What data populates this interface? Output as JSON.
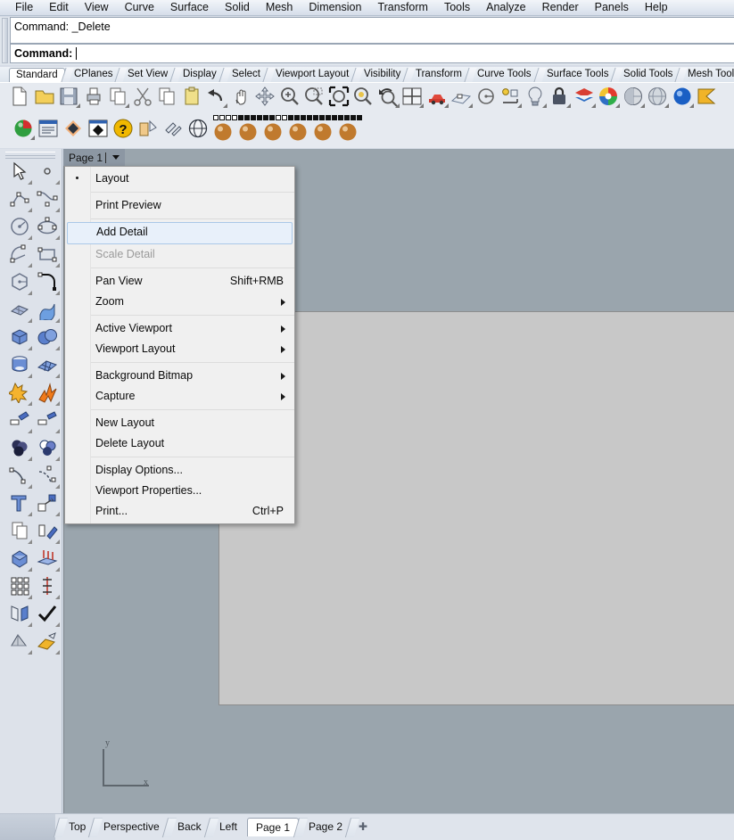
{
  "menubar": {
    "items": [
      {
        "label": "File"
      },
      {
        "label": "Edit"
      },
      {
        "label": "View"
      },
      {
        "label": "Curve"
      },
      {
        "label": "Surface"
      },
      {
        "label": "Solid"
      },
      {
        "label": "Mesh"
      },
      {
        "label": "Dimension"
      },
      {
        "label": "Transform"
      },
      {
        "label": "Tools"
      },
      {
        "label": "Analyze"
      },
      {
        "label": "Render"
      },
      {
        "label": "Panels"
      },
      {
        "label": "Help"
      }
    ]
  },
  "command": {
    "history": "Command: _Delete",
    "prompt_label": "Command:",
    "input_value": ""
  },
  "toolbar_tabs": {
    "active": "Standard",
    "items": [
      {
        "label": "Standard"
      },
      {
        "label": "CPlanes"
      },
      {
        "label": "Set View"
      },
      {
        "label": "Display"
      },
      {
        "label": "Select"
      },
      {
        "label": "Viewport Layout"
      },
      {
        "label": "Visibility"
      },
      {
        "label": "Transform"
      },
      {
        "label": "Curve Tools"
      },
      {
        "label": "Surface Tools"
      },
      {
        "label": "Solid Tools"
      },
      {
        "label": "Mesh Tools"
      }
    ]
  },
  "toolbar_row1": {
    "icons": [
      {
        "name": "new-file-icon",
        "flyout": false
      },
      {
        "name": "open-folder-icon",
        "flyout": false
      },
      {
        "name": "save-icon",
        "flyout": true
      },
      {
        "name": "print-icon",
        "flyout": false
      },
      {
        "name": "copy-to-clipboard-icon",
        "flyout": true
      },
      {
        "name": "cut-scissors-icon",
        "flyout": false
      },
      {
        "name": "copy-icon",
        "flyout": false
      },
      {
        "name": "paste-icon",
        "flyout": false
      },
      {
        "name": "undo-icon",
        "flyout": true
      },
      {
        "name": "pan-hand-icon",
        "flyout": false
      },
      {
        "name": "move-gumball-icon",
        "flyout": false
      },
      {
        "name": "zoom-in-icon",
        "flyout": false
      },
      {
        "name": "zoom-window-icon",
        "flyout": false
      },
      {
        "name": "zoom-extents-icon",
        "flyout": false
      },
      {
        "name": "zoom-selected-icon",
        "flyout": false
      },
      {
        "name": "zoom-previous-icon",
        "flyout": true
      },
      {
        "name": "viewport-layout-icon",
        "flyout": true
      },
      {
        "name": "car-render-icon",
        "flyout": true
      },
      {
        "name": "grid-snap-icon",
        "flyout": true
      },
      {
        "name": "circle-center-icon",
        "flyout": false
      },
      {
        "name": "object-snap-icon",
        "flyout": true
      },
      {
        "name": "light-bulb-icon",
        "flyout": true
      },
      {
        "name": "lock-icon",
        "flyout": true
      },
      {
        "name": "layers-icon",
        "flyout": true
      },
      {
        "name": "color-wheel-icon",
        "flyout": true
      },
      {
        "name": "shade-sphere-icon",
        "flyout": true
      },
      {
        "name": "ghosted-sphere-icon",
        "flyout": true
      },
      {
        "name": "rendered-sphere-icon",
        "flyout": true
      },
      {
        "name": "flag-render-icon",
        "flyout": false
      }
    ]
  },
  "toolbar_row2": {
    "icons": [
      {
        "name": "render-sphere-green-icon",
        "flyout": true
      },
      {
        "name": "properties-panel-icon",
        "flyout": false
      },
      {
        "name": "diamond-orange-icon",
        "flyout": false
      },
      {
        "name": "diamond-window-icon",
        "flyout": false
      },
      {
        "name": "help-question-icon",
        "flyout": false
      },
      {
        "name": "extrude-cone-icon",
        "flyout": false
      },
      {
        "name": "join-icon",
        "flyout": false
      },
      {
        "name": "wireframe-sphere-icon",
        "flyout": false
      },
      {
        "name": "material-sphere-icon",
        "flyout": false
      },
      {
        "name": "material-sphere-2-icon",
        "flyout": false
      },
      {
        "name": "material-sphere-3-icon",
        "flyout": false
      },
      {
        "name": "material-sphere-4-icon",
        "flyout": false
      },
      {
        "name": "material-sphere-5-icon",
        "flyout": false
      },
      {
        "name": "material-sphere-6-icon",
        "flyout": false
      }
    ]
  },
  "sidebar": {
    "icons": [
      {
        "name": "select-arrow-icon"
      },
      {
        "name": "point-icon"
      },
      {
        "name": "polyline-icon"
      },
      {
        "name": "control-point-curve-icon"
      },
      {
        "name": "circle-icon"
      },
      {
        "name": "ellipse-icon"
      },
      {
        "name": "arc-icon"
      },
      {
        "name": "rectangle-icon"
      },
      {
        "name": "polygon-icon"
      },
      {
        "name": "curve-fillet-icon"
      },
      {
        "name": "surface-from-points-icon"
      },
      {
        "name": "surface-loft-icon"
      },
      {
        "name": "box-solid-icon"
      },
      {
        "name": "sphere-solid-icon"
      },
      {
        "name": "cylinder-solid-icon"
      },
      {
        "name": "surface-mesh-icon"
      },
      {
        "name": "boolean-union-icon"
      },
      {
        "name": "explode-icon"
      },
      {
        "name": "trim-icon"
      },
      {
        "name": "split-icon"
      },
      {
        "name": "boolean-difference-icon"
      },
      {
        "name": "boolean-intersect-icon"
      },
      {
        "name": "offset-curve-icon"
      },
      {
        "name": "blend-curve-icon"
      },
      {
        "name": "text-tool-icon"
      },
      {
        "name": "scale-icon"
      },
      {
        "name": "copy-objects-icon"
      },
      {
        "name": "rotate-icon"
      },
      {
        "name": "cap-solid-icon"
      },
      {
        "name": "extrude-surface-icon"
      },
      {
        "name": "array-grid-icon"
      },
      {
        "name": "dimension-linear-icon"
      },
      {
        "name": "mirror-icon"
      },
      {
        "name": "check-validate-icon"
      },
      {
        "name": "mesh-from-surface-icon"
      },
      {
        "name": "render-preview-icon"
      }
    ]
  },
  "viewport": {
    "title": "Page 1",
    "background_color": "#9aa5ad",
    "sheet_color": "#c8c8c8",
    "axis": {
      "x_label": "x",
      "y_label": "y"
    }
  },
  "context_menu": {
    "items": [
      {
        "label": "Layout",
        "type": "item",
        "checked": true,
        "disabled": false,
        "accel": "",
        "submenu": false
      },
      {
        "type": "separator"
      },
      {
        "label": "Print Preview",
        "type": "item",
        "checked": false,
        "disabled": false,
        "accel": "",
        "submenu": false
      },
      {
        "type": "separator"
      },
      {
        "label": "Add Detail",
        "type": "item",
        "checked": false,
        "disabled": false,
        "accel": "",
        "submenu": false,
        "selected": true
      },
      {
        "label": "Scale Detail",
        "type": "item",
        "checked": false,
        "disabled": true,
        "accel": "",
        "submenu": false
      },
      {
        "type": "separator"
      },
      {
        "label": "Pan View",
        "type": "item",
        "checked": false,
        "disabled": false,
        "accel": "Shift+RMB",
        "submenu": false
      },
      {
        "label": "Zoom",
        "type": "item",
        "checked": false,
        "disabled": false,
        "accel": "",
        "submenu": true
      },
      {
        "type": "separator"
      },
      {
        "label": "Active Viewport",
        "type": "item",
        "checked": false,
        "disabled": false,
        "accel": "",
        "submenu": true
      },
      {
        "label": "Viewport Layout",
        "type": "item",
        "checked": false,
        "disabled": false,
        "accel": "",
        "submenu": true
      },
      {
        "type": "separator"
      },
      {
        "label": "Background Bitmap",
        "type": "item",
        "checked": false,
        "disabled": false,
        "accel": "",
        "submenu": true
      },
      {
        "label": "Capture",
        "type": "item",
        "checked": false,
        "disabled": false,
        "accel": "",
        "submenu": true
      },
      {
        "type": "separator"
      },
      {
        "label": "New Layout",
        "type": "item",
        "checked": false,
        "disabled": false,
        "accel": "",
        "submenu": false
      },
      {
        "label": "Delete Layout",
        "type": "item",
        "checked": false,
        "disabled": false,
        "accel": "",
        "submenu": false
      },
      {
        "type": "separator"
      },
      {
        "label": "Display Options...",
        "type": "item",
        "checked": false,
        "disabled": false,
        "accel": "",
        "submenu": false
      },
      {
        "label": "Viewport Properties...",
        "type": "item",
        "checked": false,
        "disabled": false,
        "accel": "",
        "submenu": false
      },
      {
        "label": "Print...",
        "type": "item",
        "checked": false,
        "disabled": false,
        "accel": "Ctrl+P",
        "submenu": false
      }
    ]
  },
  "bottom_tabs": {
    "active": "Page 1",
    "items": [
      {
        "label": "Top"
      },
      {
        "label": "Perspective"
      },
      {
        "label": "Back"
      },
      {
        "label": "Left"
      },
      {
        "label": "Page 1"
      },
      {
        "label": "Page 2"
      }
    ],
    "add_label": "✚"
  }
}
